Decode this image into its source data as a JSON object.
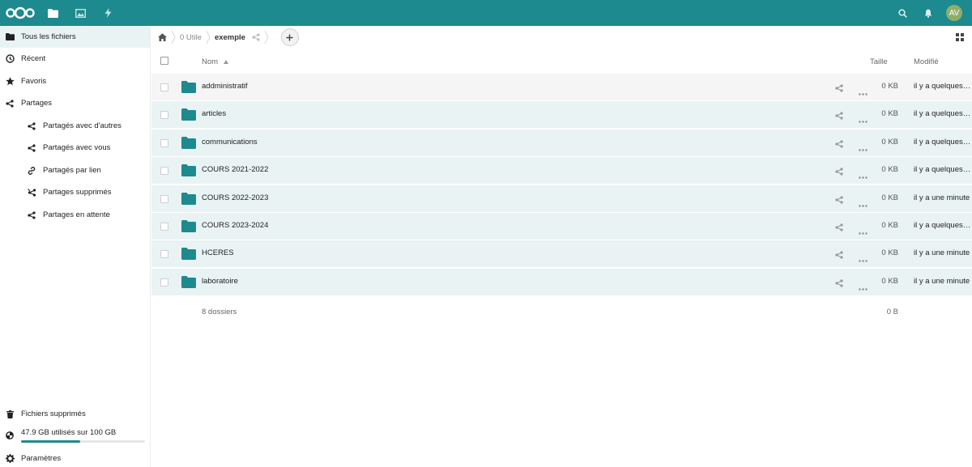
{
  "header": {
    "apps": [
      {
        "name": "files-icon"
      },
      {
        "name": "photos-icon"
      },
      {
        "name": "activity-icon"
      }
    ],
    "avatar_initials": "AV",
    "brand_color": "#1d8a8f"
  },
  "sidebar": {
    "items": [
      {
        "label": "Tous les fichiers",
        "icon": "folder-icon"
      },
      {
        "label": "Récent",
        "icon": "clock-icon"
      },
      {
        "label": "Favoris",
        "icon": "star-icon"
      },
      {
        "label": "Partages",
        "icon": "share-icon"
      }
    ],
    "sub_items": [
      {
        "label": "Partagés avec d'autres",
        "icon": "share-icon"
      },
      {
        "label": "Partagés avec vous",
        "icon": "share-icon"
      },
      {
        "label": "Partagés par lien",
        "icon": "link-icon"
      },
      {
        "label": "Partages supprimés",
        "icon": "share-deleted-icon"
      },
      {
        "label": "Partages en attente",
        "icon": "share-icon"
      }
    ],
    "trash_label": "Fichiers supprimés",
    "quota_label": "47.9 GB utilisés sur 100 GB",
    "quota_used_fraction": 0.479,
    "settings_label": "Paramètres"
  },
  "breadcrumb": {
    "items": [
      "0 Utile",
      "exemple"
    ]
  },
  "table": {
    "columns": {
      "name": "Nom",
      "size": "Taille",
      "modified": "Modifié"
    },
    "rows": [
      {
        "name": "addministratif",
        "size": "0 KB",
        "modified": "il y a quelques secondes"
      },
      {
        "name": "articles",
        "size": "0 KB",
        "modified": "il y a quelques secondes"
      },
      {
        "name": "communications",
        "size": "0 KB",
        "modified": "il y a quelques secondes"
      },
      {
        "name": "COURS 2021-2022",
        "size": "0 KB",
        "modified": "il y a quelques secondes"
      },
      {
        "name": "COURS 2022-2023",
        "size": "0 KB",
        "modified": "il y a une minute"
      },
      {
        "name": "COURS 2023-2024",
        "size": "0 KB",
        "modified": "il y a quelques secondes"
      },
      {
        "name": "HCERES",
        "size": "0 KB",
        "modified": "il y a une minute"
      },
      {
        "name": "laboratoire",
        "size": "0 KB",
        "modified": "il y a une minute"
      }
    ],
    "summary_count": "8 dossiers",
    "summary_size": "0 B"
  }
}
